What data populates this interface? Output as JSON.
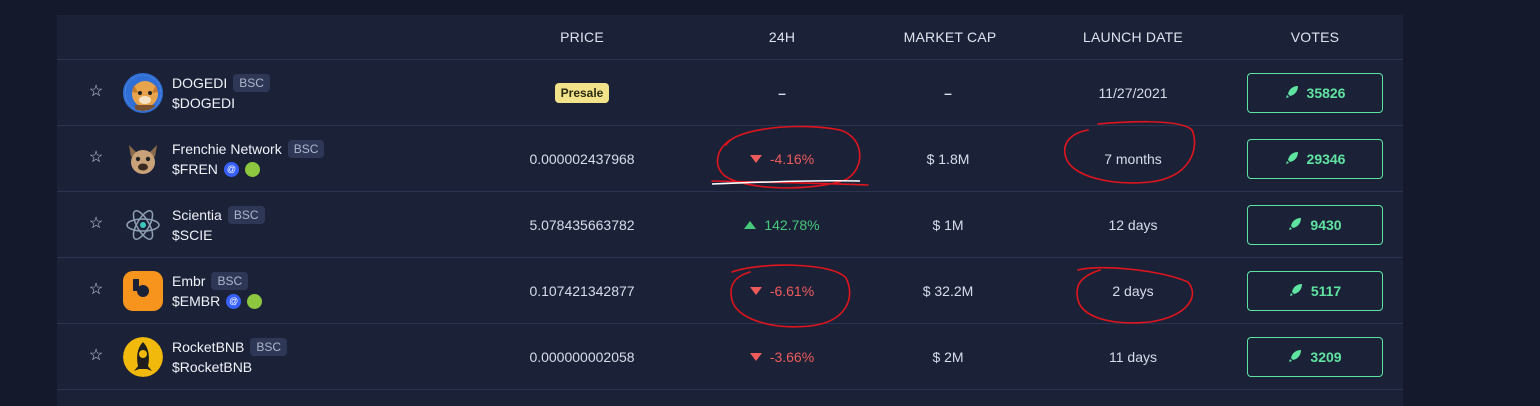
{
  "header": {
    "price": "PRICE",
    "change_24h": "24H",
    "market_cap": "MARKET CAP",
    "launch_date": "LAUNCH DATE",
    "votes": "VOTES"
  },
  "rows": [
    {
      "name": "DOGEDI",
      "chain": "BSC",
      "ticker": "$DOGEDI",
      "price": "",
      "presale_label": "Presale",
      "change": "–",
      "change_dir": "none",
      "market_cap": "–",
      "launch": "11/27/2021",
      "votes": "35826",
      "logo_icon": "dogedi-logo",
      "ticker_icons": []
    },
    {
      "name": "Frenchie Network",
      "chain": "BSC",
      "ticker": "$FREN",
      "price": "0.000002437968",
      "presale_label": "",
      "change": "-4.16%",
      "change_dir": "down",
      "market_cap": "$ 1.8M",
      "launch": "7 months",
      "votes": "29346",
      "logo_icon": "frenchie-dog-logo",
      "ticker_icons": [
        "coinmarketcap-icon",
        "coingecko-icon"
      ]
    },
    {
      "name": "Scientia",
      "chain": "BSC",
      "ticker": "$SCIE",
      "price": "5.078435663782",
      "presale_label": "",
      "change": "142.78%",
      "change_dir": "up",
      "market_cap": "$ 1M",
      "launch": "12 days",
      "votes": "9430",
      "logo_icon": "atom-logo",
      "ticker_icons": []
    },
    {
      "name": "Embr",
      "chain": "BSC",
      "ticker": "$EMBR",
      "price": "0.107421342877",
      "presale_label": "",
      "change": "-6.61%",
      "change_dir": "down",
      "market_cap": "$ 32.2M",
      "launch": "2 days",
      "votes": "5117",
      "logo_icon": "embr-logo",
      "ticker_icons": [
        "coinmarketcap-icon",
        "coingecko-icon"
      ]
    },
    {
      "name": "RocketBNB",
      "chain": "BSC",
      "ticker": "$RocketBNB",
      "price": "0.000000002058",
      "presale_label": "",
      "change": "-3.66%",
      "change_dir": "down",
      "market_cap": "$ 2M",
      "launch": "11 days",
      "votes": "3209",
      "logo_icon": "rocket-bnb-logo",
      "ticker_icons": []
    }
  ],
  "colors": {
    "background": "#141a2c",
    "table": "#1b2238",
    "negative": "#ef5b5b",
    "positive": "#46c87a",
    "vote_accent": "#5fe3a1",
    "presale_badge": "#f2e38a",
    "annotation": "#e0141c"
  }
}
